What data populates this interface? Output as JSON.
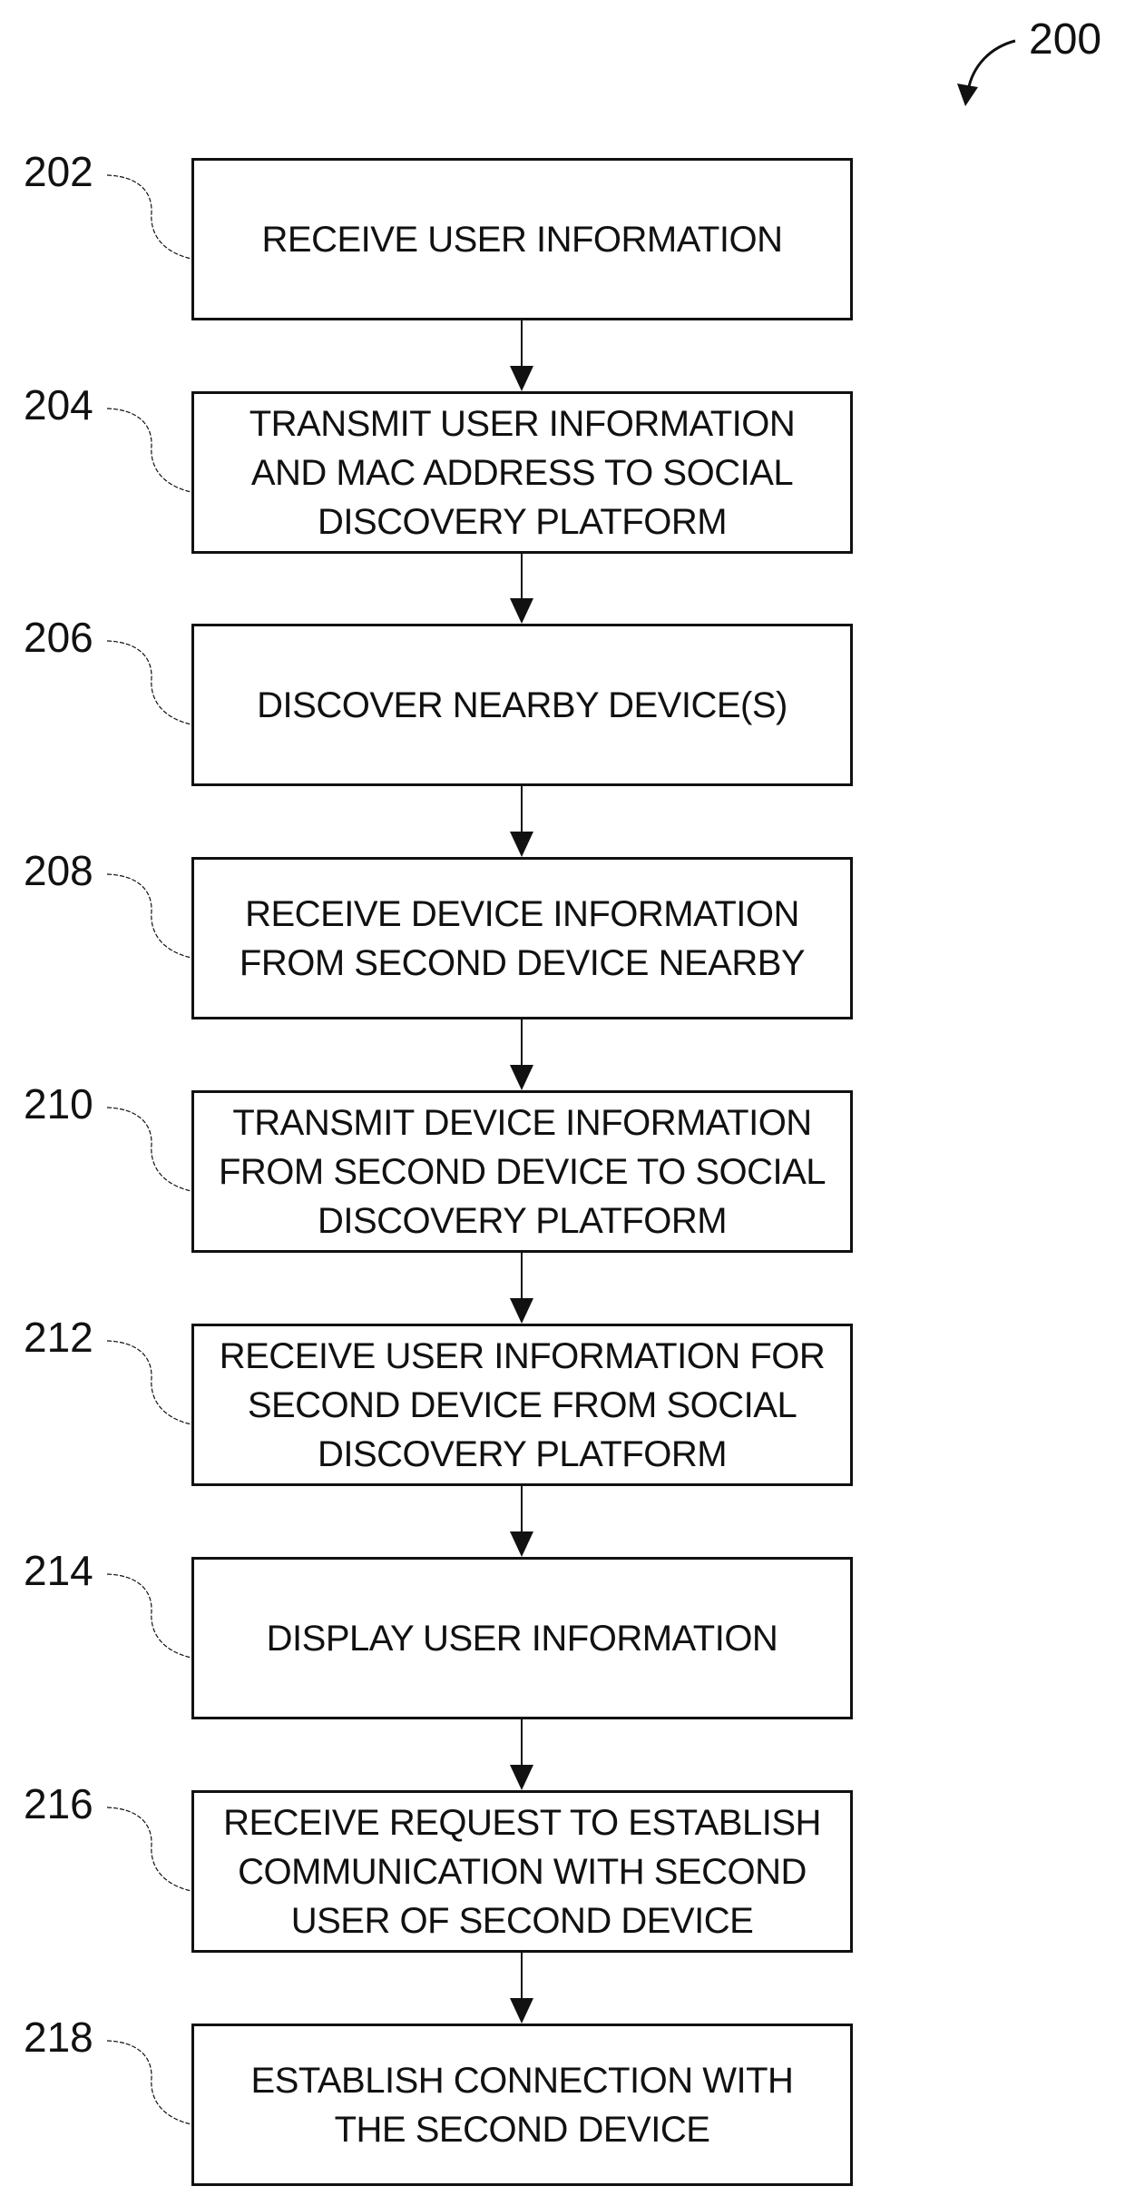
{
  "figure": {
    "reference_numeral": "200",
    "type": "flowchart"
  },
  "steps": [
    {
      "ref": "202",
      "text": "RECEIVE USER INFORMATION"
    },
    {
      "ref": "204",
      "text": "TRANSMIT USER INFORMATION\nAND MAC ADDRESS TO SOCIAL\nDISCOVERY PLATFORM"
    },
    {
      "ref": "206",
      "text": "DISCOVER NEARBY DEVICE(S)"
    },
    {
      "ref": "208",
      "text": "RECEIVE DEVICE INFORMATION\nFROM SECOND DEVICE NEARBY"
    },
    {
      "ref": "210",
      "text": "TRANSMIT DEVICE INFORMATION\nFROM SECOND DEVICE TO SOCIAL\nDISCOVERY PLATFORM"
    },
    {
      "ref": "212",
      "text": "RECEIVE USER INFORMATION FOR\nSECOND DEVICE FROM SOCIAL\nDISCOVERY PLATFORM"
    },
    {
      "ref": "214",
      "text": "DISPLAY USER INFORMATION"
    },
    {
      "ref": "216",
      "text": "RECEIVE REQUEST TO ESTABLISH\nCOMMUNICATION WITH SECOND\nUSER OF SECOND DEVICE"
    },
    {
      "ref": "218",
      "text": "ESTABLISH CONNECTION WITH\nTHE SECOND DEVICE"
    }
  ],
  "connections": [
    {
      "from": "202",
      "to": "204"
    },
    {
      "from": "204",
      "to": "206"
    },
    {
      "from": "206",
      "to": "208"
    },
    {
      "from": "208",
      "to": "210"
    },
    {
      "from": "210",
      "to": "212"
    },
    {
      "from": "212",
      "to": "214"
    },
    {
      "from": "214",
      "to": "216"
    },
    {
      "from": "216",
      "to": "218"
    }
  ],
  "colors": {
    "line": "#111111",
    "background": "#ffffff"
  }
}
